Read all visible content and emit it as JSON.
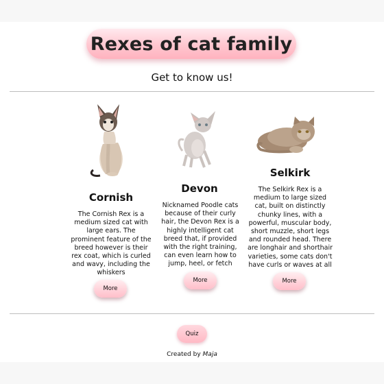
{
  "header": {
    "title": "Rexes of cat family",
    "subtitle": "Get to know us!"
  },
  "cards": [
    {
      "name": "Cornish",
      "description": "The Cornish Rex is a medium sized cat with large ears. The prominent feature of the breed however is their rex coat, which is curled and wavy, including the whiskers",
      "button": "More",
      "image": "cornish-rex-cat-photo"
    },
    {
      "name": "Devon",
      "description": "Nicknamed Poodle cats because of their curly hair, the Devon Rex is a highly intelligent cat breed that, if provided with the right training, can even learn how to jump, heel, or fetch",
      "button": "More",
      "image": "devon-rex-cat-photo"
    },
    {
      "name": "Selkirk",
      "description": "The Selkirk Rex is a medium to large sized cat, built on distinctly chunky lines, with a powerful, muscular body, short muzzle, short legs and rounded head. There are longhair and shorthair varieties, some cats don't have curls or waves at all",
      "button": "More",
      "image": "selkirk-rex-cat-photo"
    }
  ],
  "quiz": {
    "label": "Quiz"
  },
  "footer": {
    "prefix": "Created by",
    "author": "Maja"
  },
  "colors": {
    "pill_pink": "#ffc6cf",
    "divider": "#bdbdbd",
    "background": "#ffffff"
  }
}
